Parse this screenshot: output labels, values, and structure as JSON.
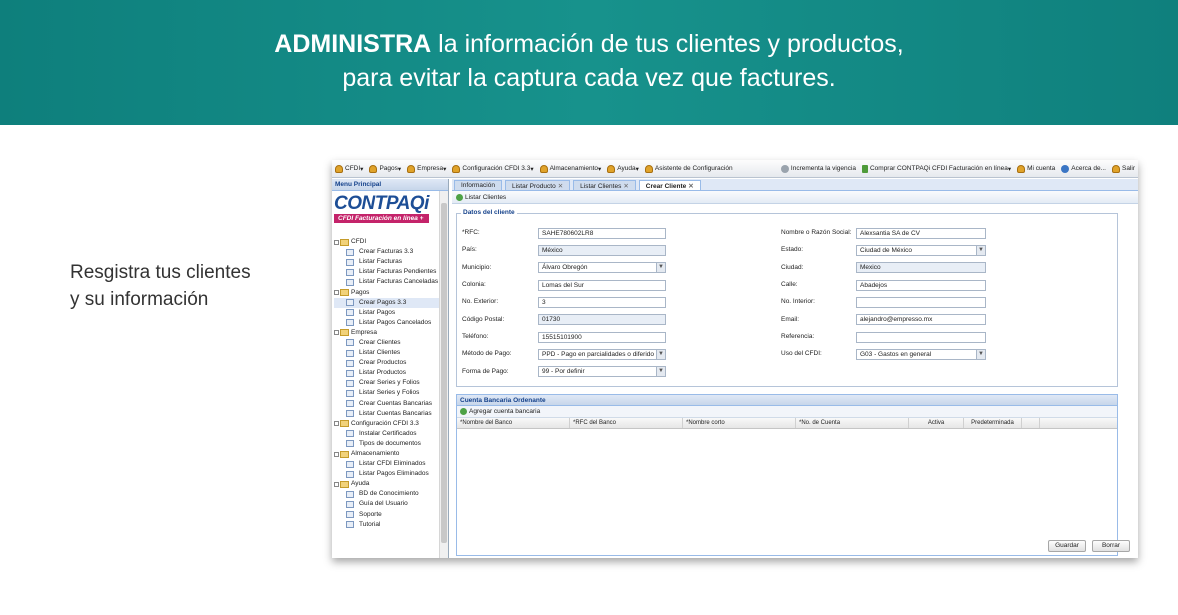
{
  "banner": {
    "strong": "ADMINISTRA",
    "line1_rest": " la información de tus clientes y productos,",
    "line2": "para evitar la captura cada vez que factures."
  },
  "caption": {
    "line1": "Resgistra tus clientes",
    "line2": "y su información"
  },
  "menubar": {
    "left": [
      "CFDI",
      "Pagos",
      "Empresa",
      "Configuración CFDI 3.3",
      "Almacenamiento",
      "Ayuda",
      "Asistente de Configuración"
    ],
    "right": [
      "Incrementa la vigencia",
      "Comprar CONTPAQi CFDI Facturación en línea",
      "Mi cuenta",
      "Acerca de...",
      "Salir"
    ]
  },
  "sidebar": {
    "header": "Menu Principal",
    "brand": "CONTPAQi",
    "brand_sub": "CFDI Facturación en línea +",
    "tree": [
      {
        "label": "CFDI",
        "type": "folder"
      },
      {
        "label": "Crear Facturas 3.3",
        "type": "leaf"
      },
      {
        "label": "Listar Facturas",
        "type": "leaf"
      },
      {
        "label": "Listar Facturas Pendientes",
        "type": "leaf"
      },
      {
        "label": "Listar Facturas Canceladas",
        "type": "leaf"
      },
      {
        "label": "Pagos",
        "type": "folder"
      },
      {
        "label": "Crear Pagos 3.3",
        "type": "leaf",
        "selected": true
      },
      {
        "label": "Listar Pagos",
        "type": "leaf"
      },
      {
        "label": "Listar Pagos Cancelados",
        "type": "leaf"
      },
      {
        "label": "Empresa",
        "type": "folder"
      },
      {
        "label": "Crear Clientes",
        "type": "leaf"
      },
      {
        "label": "Listar Clientes",
        "type": "leaf"
      },
      {
        "label": "Crear Productos",
        "type": "leaf"
      },
      {
        "label": "Listar Productos",
        "type": "leaf"
      },
      {
        "label": "Crear Series y Folios",
        "type": "leaf"
      },
      {
        "label": "Listar Series y Folios",
        "type": "leaf"
      },
      {
        "label": "Crear Cuentas Bancarias",
        "type": "leaf"
      },
      {
        "label": "Listar Cuentas Bancarias",
        "type": "leaf"
      },
      {
        "label": "Configuración CFDI 3.3",
        "type": "folder"
      },
      {
        "label": "Instalar Certificados",
        "type": "leaf"
      },
      {
        "label": "Tipos de documentos",
        "type": "leaf"
      },
      {
        "label": "Almacenamiento",
        "type": "folder"
      },
      {
        "label": "Listar CFDI Eliminados",
        "type": "leaf"
      },
      {
        "label": "Listar Pagos Eliminados",
        "type": "leaf"
      },
      {
        "label": "Ayuda",
        "type": "folder"
      },
      {
        "label": "BD de Conocimiento",
        "type": "leaf"
      },
      {
        "label": "Guía del Usuario",
        "type": "leaf"
      },
      {
        "label": "Soporte",
        "type": "leaf"
      },
      {
        "label": "Tutorial",
        "type": "leaf"
      }
    ]
  },
  "tabs": [
    {
      "label": "Información",
      "closable": false,
      "active": false
    },
    {
      "label": "Listar Producto",
      "closable": true,
      "active": false
    },
    {
      "label": "Listar Clientes",
      "closable": true,
      "active": false
    },
    {
      "label": "Crear Cliente",
      "closable": true,
      "active": true
    }
  ],
  "toolbar": {
    "list_clients": "Listar Clientes"
  },
  "form": {
    "legend": "Datos del cliente",
    "rfc_label": "*RFC:",
    "rfc": "SAHE780602LR8",
    "pais_label": "País:",
    "pais": "México",
    "municipio_label": "Municipio:",
    "municipio": "Álvaro Obregón",
    "colonia_label": "Colonia:",
    "colonia": "Lomas del Sur",
    "noext_label": "No. Exterior:",
    "noext": "3",
    "cp_label": "Código Postal:",
    "cp": "01730",
    "tel_label": "Teléfono:",
    "tel": "15515101900",
    "metodo_label": "Método de Pago:",
    "metodo": "PPD - Pago en parcialidades o diferido",
    "forma_label": "Forma de Pago:",
    "forma": "99 - Por definir",
    "razon_label": "Nombre o Razón Social:",
    "razon": "Alexsantia SA de CV",
    "estado_label": "Estado:",
    "estado": "Ciudad de México",
    "ciudad_label": "Ciudad:",
    "ciudad": "Mexico",
    "calle_label": "Calle:",
    "calle": "Abadejos",
    "noint_label": "No. Interior:",
    "noint": "",
    "email_label": "Email:",
    "email": "alejandro@empresso.mx",
    "ref_label": "Referencia:",
    "ref": "",
    "uso_label": "Uso del CFDI:",
    "uso": "G03 - Gastos en general"
  },
  "bank": {
    "title": "Cuenta Bancaria Ordenante",
    "add": "Agregar cuenta bancaria",
    "columns": [
      "*Nombre del Banco",
      "*RFC del Banco",
      "*Nombre corto",
      "*No. de Cuenta",
      "Activa",
      "Predeterminada"
    ]
  },
  "buttons": {
    "save": "Guardar",
    "clear": "Borrar"
  },
  "colors": {
    "banner": "#138a86",
    "accent": "#15428b",
    "brand": "#1d4e96",
    "brand_sub": "#c4236a"
  }
}
